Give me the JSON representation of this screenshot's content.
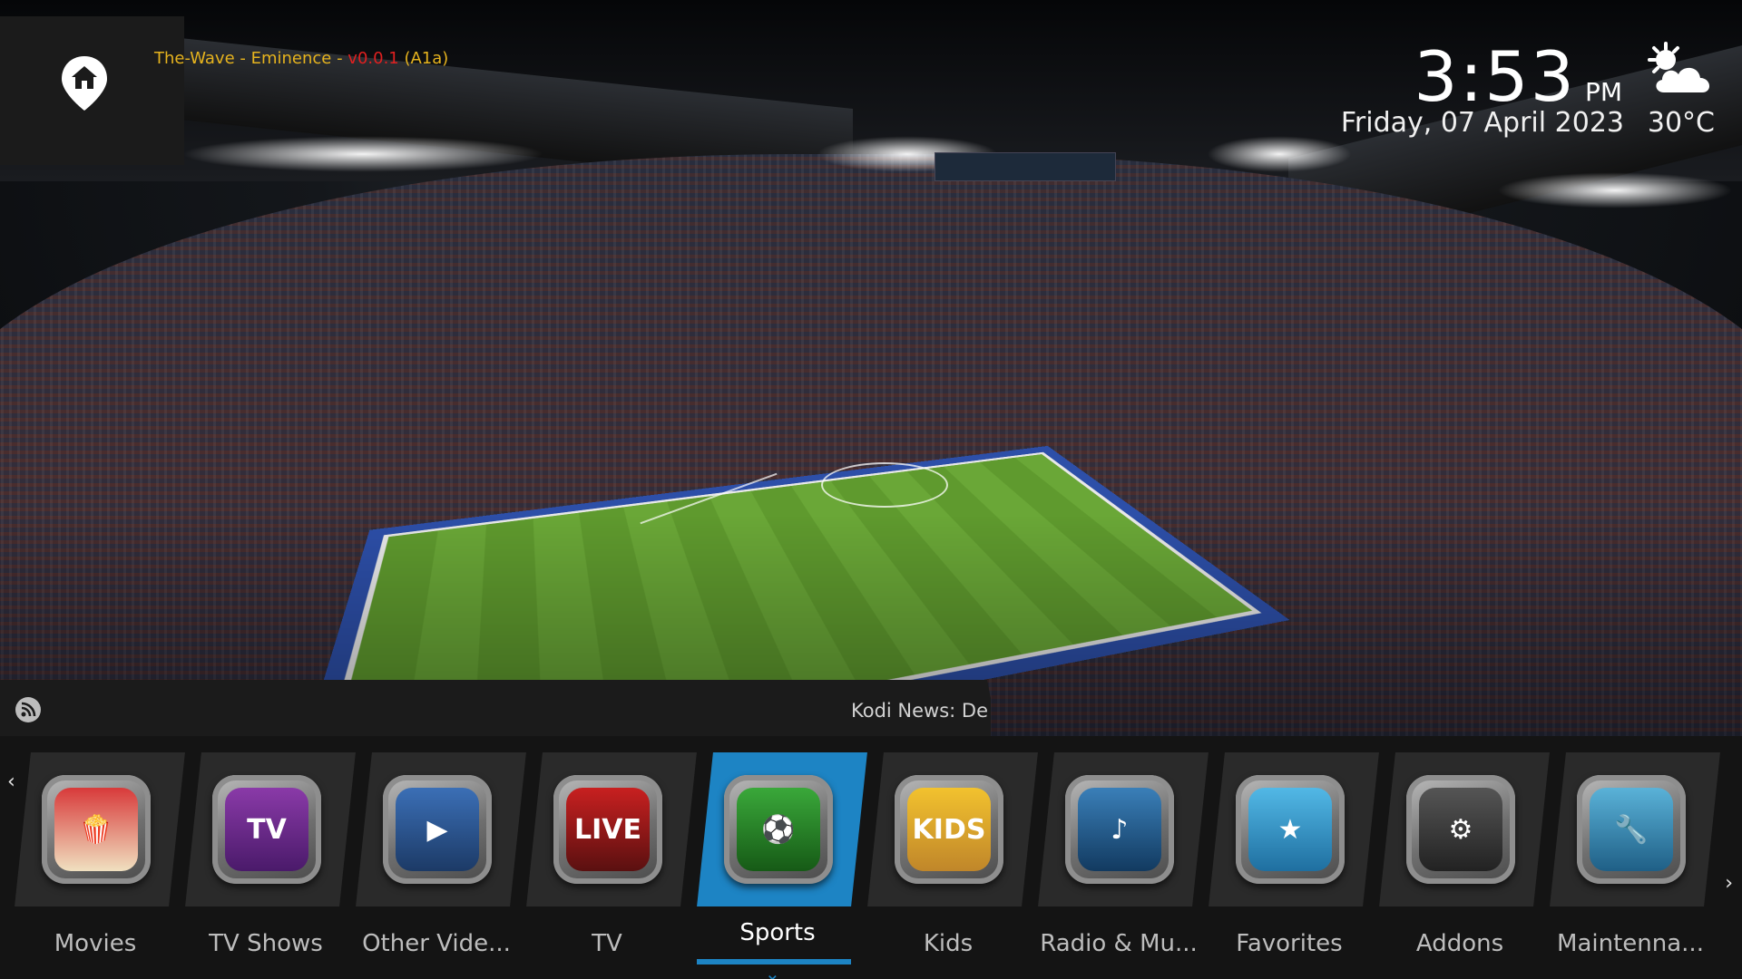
{
  "header": {
    "build_name": "The-Wave - Eminence - ",
    "build_version": "v0.0.1",
    "build_suffix": " (A1a)",
    "home_icon": "home-icon"
  },
  "clock": {
    "time": "3:53",
    "ampm": "PM",
    "date": "Friday, 07 April 2023",
    "temperature": "30°C",
    "weather_icon": "partly-cloudy-icon"
  },
  "rss": {
    "icon": "rss-icon",
    "text": "Kodi News: De"
  },
  "menu": {
    "left_arrow": "‹",
    "right_arrow": "›",
    "active_index": 4,
    "items": [
      {
        "label": "Movies",
        "icon": "popcorn-clapper-icon"
      },
      {
        "label": "TV Shows",
        "icon": "tv-series-icon"
      },
      {
        "label": "Other Vide...",
        "icon": "video-camera-icon"
      },
      {
        "label": "TV",
        "icon": "live-tv-icon"
      },
      {
        "label": "Sports",
        "icon": "soccer-tv-icon"
      },
      {
        "label": "Kids",
        "icon": "kids-icon"
      },
      {
        "label": "Radio & Mu...",
        "icon": "radio-music-icon"
      },
      {
        "label": "Favorites",
        "icon": "star-favorites-icon"
      },
      {
        "label": "Addons",
        "icon": "addons-icon"
      },
      {
        "label": "Maintenna...",
        "icon": "maintenance-tools-icon"
      }
    ]
  },
  "colors": {
    "accent": "#1d84c4",
    "build_name": "#e6b31e",
    "build_version": "#e02020"
  }
}
